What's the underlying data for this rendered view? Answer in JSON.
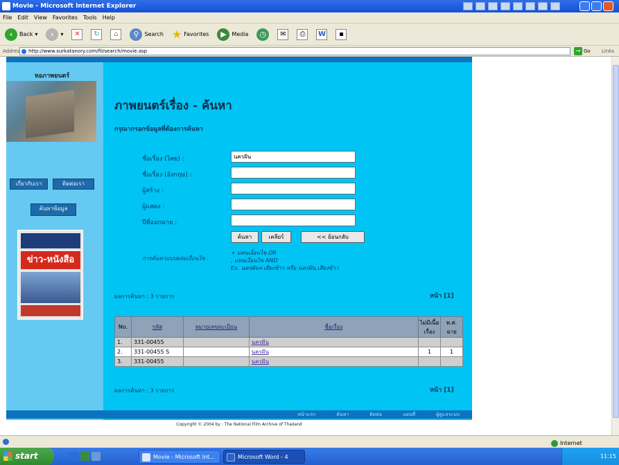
{
  "window": {
    "title": "Movie - Microsoft Internet Explorer"
  },
  "menu": [
    "File",
    "Edit",
    "View",
    "Favorites",
    "Tools",
    "Help"
  ],
  "toolbar": {
    "back": "Back",
    "search": "Search",
    "favorites": "Favorites",
    "media": "Media"
  },
  "address": {
    "label": "Address",
    "url": "http://www.surkatanory.com/fil/search/movie.asp",
    "go": "Go",
    "links": "Links"
  },
  "site": {
    "logo": "หอภาพยนตร์",
    "nav": [
      "เกี่ยวกับเรา",
      "ติดต่อเรา"
    ],
    "nav_button": "ค้นหาข้อมูล",
    "cover_text": "ข่าว-หนังสือ"
  },
  "page": {
    "title": "ภาพยนตร์เรื่อง - ค้นหา",
    "subtitle": "กรุณากรอกข้อมูลที่ต้องการค้นหา",
    "fields": [
      {
        "label": "ชื่อเรื่อง (ไทย) :",
        "value": "นครฝัน"
      },
      {
        "label": "ชื่อเรื่อง (อังกฤษ) :",
        "value": ""
      },
      {
        "label": "ผู้สร้าง :",
        "value": ""
      },
      {
        "label": "ผู้แสดง :",
        "value": ""
      },
      {
        "label": "ปีที่ออกฉาย :",
        "value": ""
      }
    ],
    "buttons": {
      "search": "ค้นหา",
      "clear": "เคลียร์",
      "back": "<< ย้อนกลับ"
    },
    "hint_label": "การค้นหาแบบผสมเงื่อนไข :",
    "hints": [
      "+ แทนเงื่อนไข OR",
      ", แทนเงื่อนไข AND",
      "Ex. นครฝัน+เสียงข้าว หรือ นครฝัน,เสียงข้าว"
    ],
    "results_top": "ผลการค้นหา : 3 รายการ",
    "results_bottom": "ผลการค้นหา : 3 รายการ",
    "pager_top": "หน้า [1]",
    "pager_bottom": "หน้า [1]"
  },
  "table": {
    "headers": [
      "No.",
      "รหัส",
      "หมายเลขทะเบียน",
      "ชื่อเรื่อง",
      "ไม่มีเนื้อเรื่อง",
      "พ.ศ. ฉาย"
    ],
    "rows": [
      {
        "no": "1.",
        "code": "331-00455",
        "reg": "",
        "title": "นครฝัน",
        "c5": "",
        "c6": ""
      },
      {
        "no": "2.",
        "code": "331-00455 S",
        "reg": "",
        "title": "นครฝัน",
        "c5": "1",
        "c6": "1"
      },
      {
        "no": "3.",
        "code": "331-00455",
        "reg": "",
        "title": "นครฝัน",
        "c5": "",
        "c6": ""
      }
    ]
  },
  "footer": {
    "links": [
      "หน้าแรก",
      "ค้นหา",
      "ติดต่อ",
      "แผนที่",
      "ผู้ดูแลระบบ"
    ],
    "copyright": "Copyright © 2004 by : The National Film Archive of Thailand"
  },
  "status": {
    "zone": "Internet"
  },
  "taskbar": {
    "start": "start",
    "tasks": [
      "Movie - Microsoft Int...",
      "Microsoft Word - 4"
    ],
    "clock": "11:15"
  }
}
